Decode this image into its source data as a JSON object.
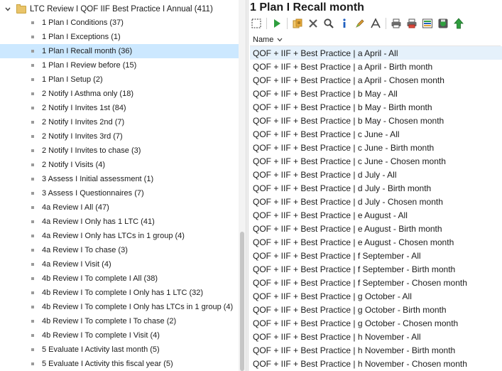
{
  "tree": {
    "root_label": "LTC Review I QOF IIF Best Practice I Annual (411)",
    "items": [
      {
        "label": "1 Plan I Conditions (37)",
        "selected": false
      },
      {
        "label": "1 Plan I Exceptions (1)",
        "selected": false
      },
      {
        "label": "1 Plan I Recall month (36)",
        "selected": true
      },
      {
        "label": "1 Plan I Review before (15)",
        "selected": false
      },
      {
        "label": "1 Plan I Setup (2)",
        "selected": false
      },
      {
        "label": "2 Notify I Asthma only (18)",
        "selected": false
      },
      {
        "label": "2 Notify I Invites 1st (84)",
        "selected": false
      },
      {
        "label": "2 Notify I Invites 2nd (7)",
        "selected": false
      },
      {
        "label": "2 Notify I Invites 3rd (7)",
        "selected": false
      },
      {
        "label": "2 Notify I Invites to chase (3)",
        "selected": false
      },
      {
        "label": "2 Notify I Visits (4)",
        "selected": false
      },
      {
        "label": "3 Assess I Initial assessment (1)",
        "selected": false
      },
      {
        "label": "3 Assess I Questionnaires (7)",
        "selected": false
      },
      {
        "label": "4a Review I All (47)",
        "selected": false
      },
      {
        "label": "4a Review I Only has 1 LTC (41)",
        "selected": false
      },
      {
        "label": "4a Review I Only has LTCs in 1 group (4)",
        "selected": false
      },
      {
        "label": "4a Review I To chase (3)",
        "selected": false
      },
      {
        "label": "4a Review I Visit (4)",
        "selected": false
      },
      {
        "label": "4b Review I To complete I All (38)",
        "selected": false
      },
      {
        "label": "4b Review I To complete I Only has 1 LTC (32)",
        "selected": false
      },
      {
        "label": "4b Review I To complete I Only has LTCs in 1 group (4)",
        "selected": false
      },
      {
        "label": "4b Review I To complete I To chase (2)",
        "selected": false
      },
      {
        "label": "4b Review I To complete I Visit (4)",
        "selected": false
      },
      {
        "label": "5 Evaluate I Activity last month (5)",
        "selected": false
      },
      {
        "label": "5 Evaluate I Activity this fiscal year (5)",
        "selected": false
      }
    ]
  },
  "panel": {
    "title": "1 Plan I Recall month",
    "column_header": "Name",
    "rows": [
      {
        "label": "QOF + IIF + Best Practice | a April - All",
        "selected": true
      },
      {
        "label": "QOF + IIF + Best Practice | a April - Birth month",
        "selected": false
      },
      {
        "label": "QOF + IIF + Best Practice | a April - Chosen month",
        "selected": false
      },
      {
        "label": "QOF + IIF + Best Practice | b May - All",
        "selected": false
      },
      {
        "label": "QOF + IIF + Best Practice | b May - Birth month",
        "selected": false
      },
      {
        "label": "QOF + IIF + Best Practice | b May - Chosen month",
        "selected": false
      },
      {
        "label": "QOF + IIF + Best Practice | c June - All",
        "selected": false
      },
      {
        "label": "QOF + IIF + Best Practice | c June - Birth month",
        "selected": false
      },
      {
        "label": "QOF + IIF + Best Practice | c June - Chosen month",
        "selected": false
      },
      {
        "label": "QOF + IIF + Best Practice | d July - All",
        "selected": false
      },
      {
        "label": "QOF + IIF + Best Practice | d July - Birth month",
        "selected": false
      },
      {
        "label": "QOF + IIF + Best Practice | d July - Chosen month",
        "selected": false
      },
      {
        "label": "QOF + IIF + Best Practice | e August - All",
        "selected": false
      },
      {
        "label": "QOF + IIF + Best Practice | e August - Birth month",
        "selected": false
      },
      {
        "label": "QOF + IIF + Best Practice | e August - Chosen month",
        "selected": false
      },
      {
        "label": "QOF + IIF + Best Practice | f September - All",
        "selected": false
      },
      {
        "label": "QOF + IIF + Best Practice | f September - Birth month",
        "selected": false
      },
      {
        "label": "QOF + IIF + Best Practice | f September - Chosen month",
        "selected": false
      },
      {
        "label": "QOF + IIF + Best Practice | g October - All",
        "selected": false
      },
      {
        "label": "QOF + IIF + Best Practice | g October - Birth month",
        "selected": false
      },
      {
        "label": "QOF + IIF + Best Practice | g October - Chosen month",
        "selected": false
      },
      {
        "label": "QOF + IIF + Best Practice | h November - All",
        "selected": false
      },
      {
        "label": "QOF + IIF + Best Practice | h November - Birth month",
        "selected": false
      },
      {
        "label": "QOF + IIF + Best Practice | h November - Chosen month",
        "selected": false
      }
    ]
  },
  "toolbar_icons": [
    "select-icon",
    "run-icon",
    "copy-icon",
    "delete-icon",
    "search-icon",
    "info-icon",
    "edit-icon",
    "font-icon",
    "print-icon",
    "print-red-icon",
    "export-icon",
    "save-icon",
    "upload-icon"
  ],
  "colors": {
    "selection_tree": "#cce8ff",
    "selection_row": "#e5f1fb",
    "run": "#2e9e3e",
    "delete": "#5a5a5a",
    "info": "#1f5fbf",
    "upload": "#2e9e3e"
  }
}
